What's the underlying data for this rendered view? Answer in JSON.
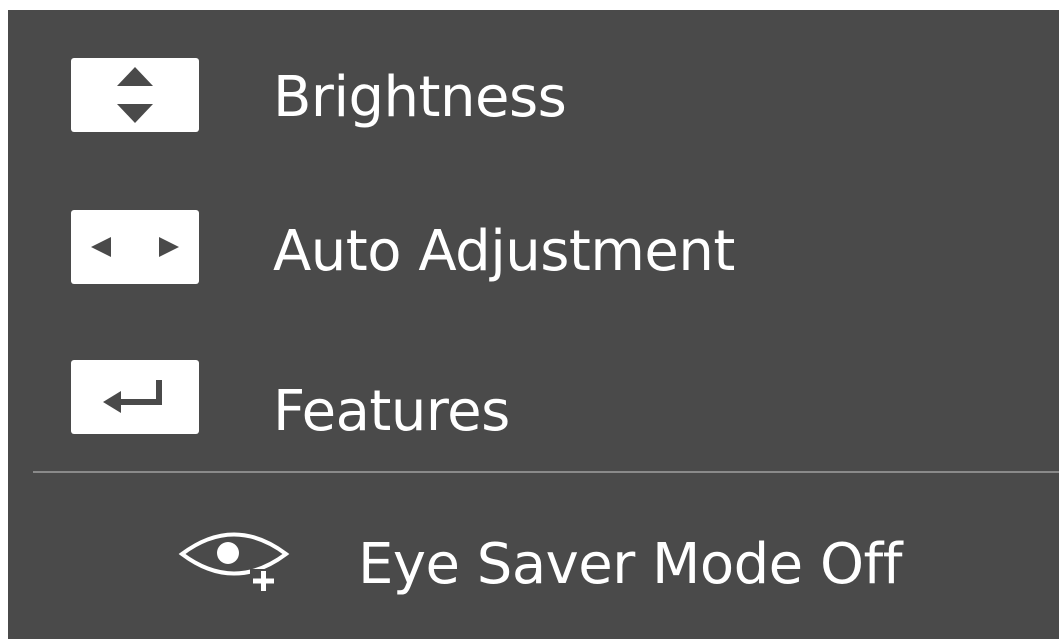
{
  "menu": {
    "items": [
      {
        "label": "Brightness",
        "icon": "up-down-arrows-icon"
      },
      {
        "label": "Auto Adjustment",
        "icon": "left-right-arrows-icon"
      },
      {
        "label": "Features",
        "icon": "enter-return-icon"
      }
    ],
    "eye_saver": {
      "label": "Eye Saver Mode Off",
      "icon": "eye-saver-icon"
    }
  },
  "colors": {
    "background": "#4a4a4a",
    "text": "#ffffff",
    "icon_key": "#ffffff",
    "icon_glyph": "#4a4a4a",
    "divider": "#8a8a8a"
  }
}
